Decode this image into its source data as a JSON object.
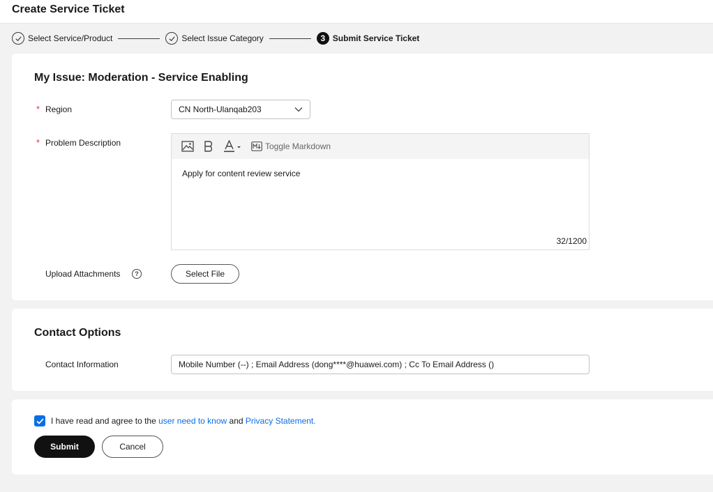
{
  "header": {
    "title": "Create Service Ticket"
  },
  "steps": [
    {
      "label": "Select Service/Product",
      "state": "done"
    },
    {
      "label": "Select Issue Category",
      "state": "done"
    },
    {
      "number": "3",
      "label": "Submit Service Ticket",
      "state": "active"
    }
  ],
  "issue": {
    "title": "My Issue: Moderation - Service Enabling",
    "required_mark": "*",
    "region": {
      "label": "Region",
      "value": "CN North-Ulanqab203"
    },
    "description": {
      "label": "Problem Description",
      "toggle_markdown": "Toggle Markdown",
      "text": "Apply for content review service",
      "counter": "32/1200"
    },
    "attachments": {
      "label": "Upload Attachments",
      "help": "?",
      "button": "Select File"
    }
  },
  "contact": {
    "title": "Contact Options",
    "label": "Contact Information",
    "value": "Mobile Number (--) ; Email Address (dong****@huawei.com) ; Cc To Email Address ()"
  },
  "agreement": {
    "checked": true,
    "prefix": "I have read and agree to the ",
    "link1": "user need to know",
    "middle": " and ",
    "link2": "Privacy Statement."
  },
  "actions": {
    "submit": "Submit",
    "cancel": "Cancel"
  },
  "colors": {
    "accent": "#0a6ee6",
    "primary_button": "#111111",
    "required": "#e0373f"
  }
}
